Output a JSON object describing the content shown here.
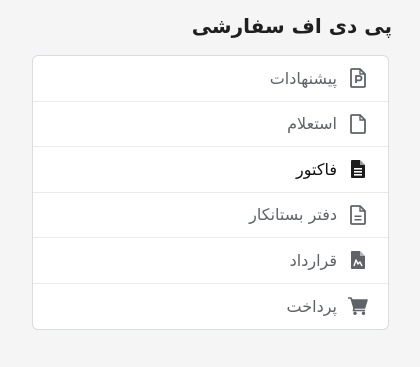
{
  "panel": {
    "title": "پی دی اف سفارشی"
  },
  "menu": {
    "items": [
      {
        "label": "پیشنهادات",
        "icon": "proposal-p-file-icon",
        "active": false
      },
      {
        "label": "استعلام",
        "icon": "blank-file-icon",
        "active": false
      },
      {
        "label": "فاکتور",
        "icon": "invoice-file-icon",
        "active": true
      },
      {
        "label": "دفتر بستانکار",
        "icon": "ledger-file-icon",
        "active": false
      },
      {
        "label": "قرارداد",
        "icon": "contract-file-icon",
        "active": false
      },
      {
        "label": "پرداخت",
        "icon": "shopping-cart-icon",
        "active": false
      }
    ]
  },
  "colors": {
    "inactive_text": "#5f6368",
    "active_text": "#111111",
    "border": "#d9dde1"
  }
}
